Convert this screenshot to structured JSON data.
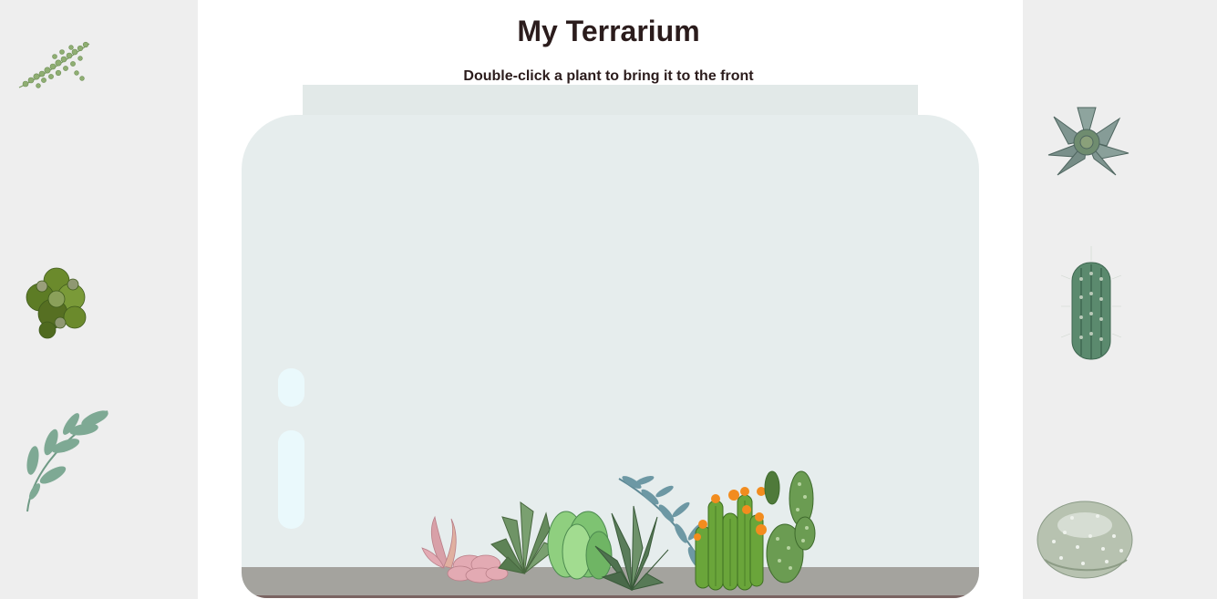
{
  "page": {
    "title": "My Terrarium",
    "subtitle": "Double-click a plant to bring it to the front"
  },
  "left_plants": [
    {
      "icon": "string-of-pearls-plant-icon"
    },
    {
      "icon": "moss-clump-plant-icon"
    },
    {
      "icon": "eucalyptus-sprig-plant-icon"
    }
  ],
  "right_plants": [
    {
      "icon": "echeveria-succulent-plant-icon"
    },
    {
      "icon": "column-cactus-plant-icon"
    },
    {
      "icon": "round-barrel-cactus-plant-icon"
    }
  ],
  "jar_plants": [
    {
      "icon": "pink-air-plant-icon"
    },
    {
      "icon": "green-succulent-plant-icon"
    },
    {
      "icon": "jade-succulent-plant-icon"
    },
    {
      "icon": "aloe-plant-icon"
    },
    {
      "icon": "blue-fern-plant-icon"
    },
    {
      "icon": "flowering-cactus-plant-icon"
    },
    {
      "icon": "paddle-cactus-plant-icon"
    }
  ],
  "colors": {
    "side_panel": "#eeeeee",
    "jar_glass": "#e6eded",
    "jar_lid": "#e2e9e8",
    "soil": "#a4a39e",
    "glare": "#eaf9fc",
    "text": "#2b1c1c"
  }
}
